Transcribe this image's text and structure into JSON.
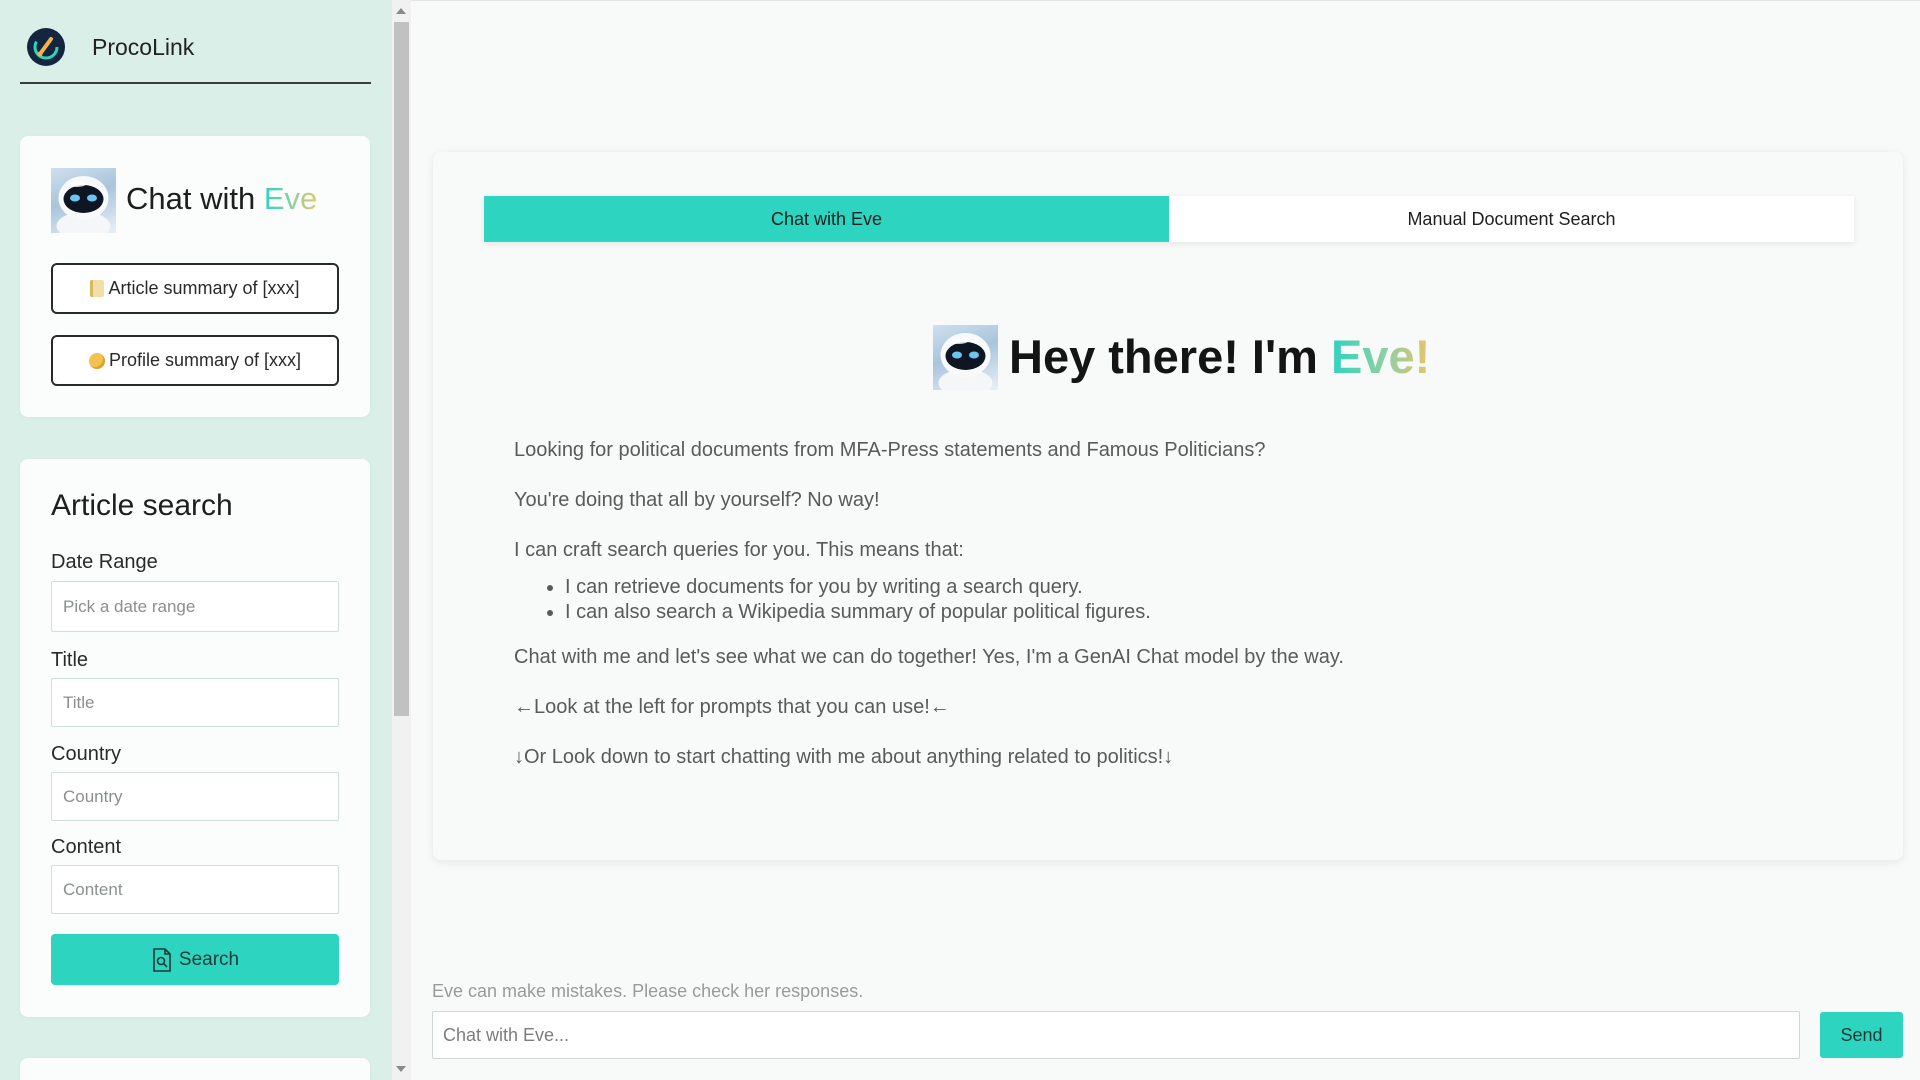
{
  "app": {
    "name": "ProcoLink",
    "logo_icon": "procolink-logo-icon",
    "accent_color": "#2dd4bf"
  },
  "sidebar": {
    "chat_card": {
      "title_prefix": "Chat with ",
      "title_accent": "Eve",
      "avatar_icon": "eve-robot-avatar-icon",
      "prompts": [
        {
          "icon": "scroll-emoji-icon",
          "label": "Article summary of [xxx]"
        },
        {
          "icon": "coin-emoji-icon",
          "label": "Profile summary of [xxx]"
        }
      ]
    },
    "article_search": {
      "title": "Article search",
      "fields": [
        {
          "label": "Date Range",
          "placeholder": "Pick a date range",
          "value": ""
        },
        {
          "label": "Title",
          "placeholder": "Title",
          "value": ""
        },
        {
          "label": "Country",
          "placeholder": "Country",
          "value": ""
        },
        {
          "label": "Content",
          "placeholder": "Content",
          "value": ""
        }
      ],
      "search_button": {
        "icon": "document-search-icon",
        "label": "Search"
      }
    }
  },
  "main": {
    "tabs": [
      {
        "label": "Chat with Eve",
        "active": true
      },
      {
        "label": "Manual Document Search",
        "active": false
      }
    ],
    "hero": {
      "prefix": "Hey there! I'm ",
      "accent": "Eve!"
    },
    "intro": {
      "line1": "Looking for political documents from MFA-Press statements and Famous Politicians?",
      "line2": "You're doing that all by yourself? No way!",
      "line3": "I can craft search queries for you. This means that:",
      "bullets": [
        "I can retrieve documents for you by writing a search query.",
        "I can also search a Wikipedia summary of popular political figures."
      ],
      "line4": "Chat with me and let's see what we can do together! Yes, I'm a GenAI Chat model by the way.",
      "line5": "←Look at the left for prompts that you can use!←",
      "line6": "↓Or Look down to start chatting with me about anything related to politics!↓"
    }
  },
  "chat_bar": {
    "disclaimer": "Eve can make mistakes. Please check her responses.",
    "placeholder": "Chat with Eve...",
    "value": "",
    "send_label": "Send"
  }
}
